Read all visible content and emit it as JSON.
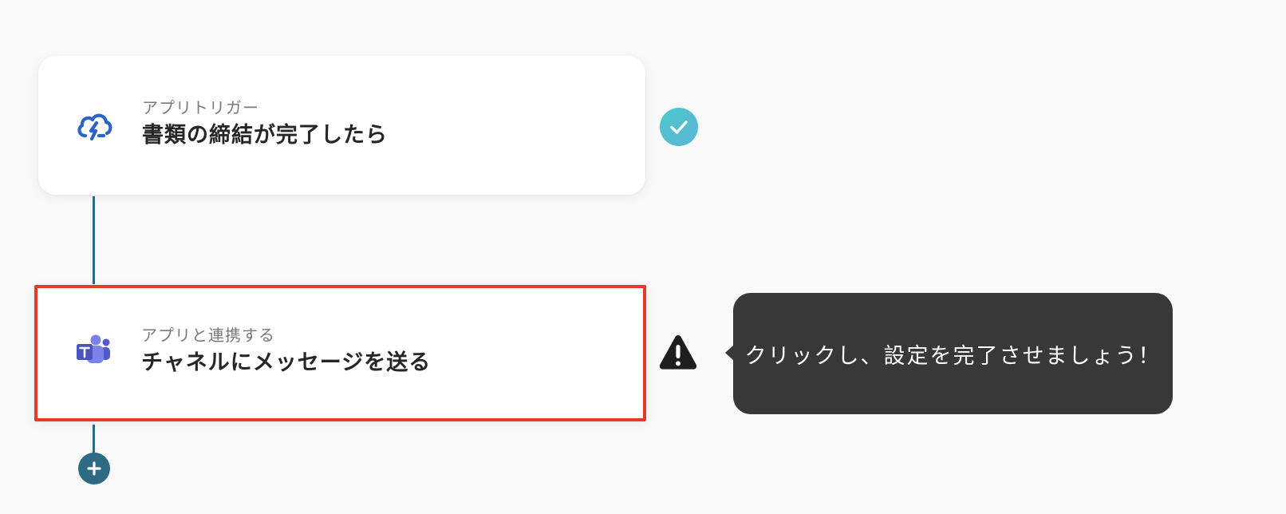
{
  "workflow": {
    "steps": [
      {
        "kind": "アプリトリガー",
        "title": "書類の締結が完了したら",
        "icon": "cloudsign-icon",
        "status": "complete"
      },
      {
        "kind": "アプリと連携する",
        "title": "チャネルにメッセージを送る",
        "icon": "microsoft-teams-icon",
        "status": "warning"
      }
    ],
    "add_step_icon": "plus-icon"
  },
  "tooltip": {
    "text": "クリックし、設定を完了させましょう！"
  },
  "colors": {
    "connector": "#2f6a85",
    "highlight_border": "#e53a2b",
    "check": "#4dc8c8",
    "tooltip_bg": "#383838"
  }
}
